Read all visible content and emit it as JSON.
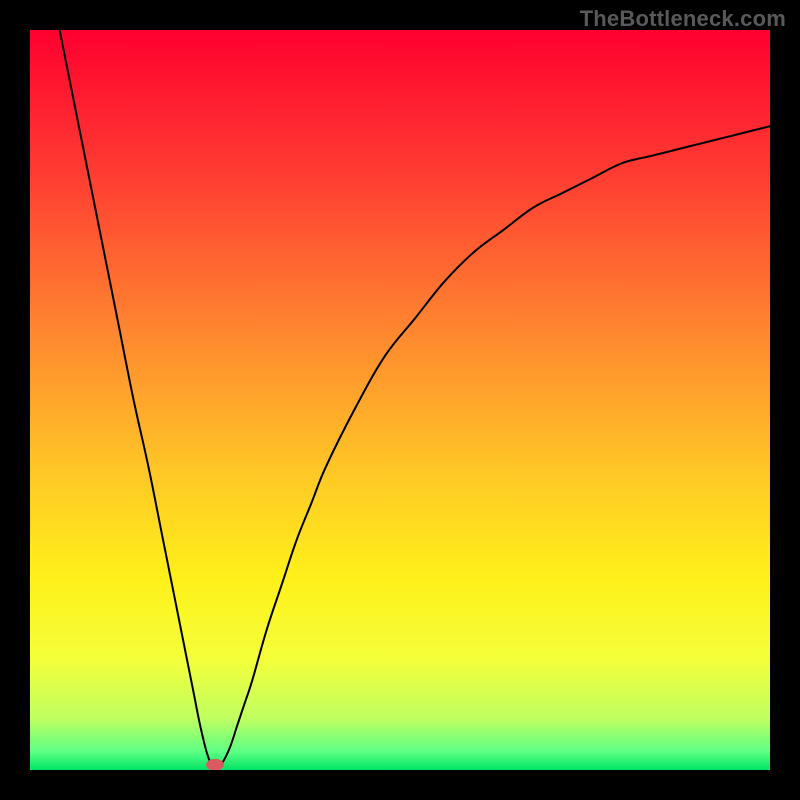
{
  "watermark": "TheBottleneck.com",
  "chart_data": {
    "type": "line",
    "title": "",
    "xlabel": "",
    "ylabel": "",
    "xlim": [
      0,
      100
    ],
    "ylim": [
      0,
      100
    ],
    "grid": false,
    "background_gradient_stops": [
      {
        "offset": 0.0,
        "color": "#ff002f"
      },
      {
        "offset": 0.2,
        "color": "#ff3e32"
      },
      {
        "offset": 0.4,
        "color": "#ff8430"
      },
      {
        "offset": 0.6,
        "color": "#ffc826"
      },
      {
        "offset": 0.74,
        "color": "#fff01a"
      },
      {
        "offset": 0.85,
        "color": "#f4ff3a"
      },
      {
        "offset": 0.93,
        "color": "#c0ff60"
      },
      {
        "offset": 0.975,
        "color": "#5eff84"
      },
      {
        "offset": 1.0,
        "color": "#00e564"
      }
    ],
    "series": [
      {
        "name": "curve",
        "color": "#000000",
        "x": [
          4,
          6,
          8,
          10,
          12,
          14,
          16,
          18,
          20,
          22,
          23,
          24,
          25,
          26,
          27,
          28,
          29,
          30,
          32,
          34,
          36,
          38,
          40,
          44,
          48,
          52,
          56,
          60,
          64,
          68,
          72,
          76,
          80,
          84,
          88,
          92,
          96,
          100
        ],
        "y": [
          100,
          90,
          80,
          70,
          60,
          50,
          41,
          31,
          21,
          11,
          6,
          2,
          0,
          1,
          3,
          6,
          9,
          12,
          19,
          25,
          31,
          36,
          41,
          49,
          56,
          61,
          66,
          70,
          73,
          76,
          78,
          80,
          82,
          83,
          84,
          85,
          86,
          87
        ]
      }
    ],
    "marker": {
      "x": 25,
      "y": 0.7,
      "color": "#db5a62",
      "rx": 1.2,
      "ry": 0.8
    }
  }
}
